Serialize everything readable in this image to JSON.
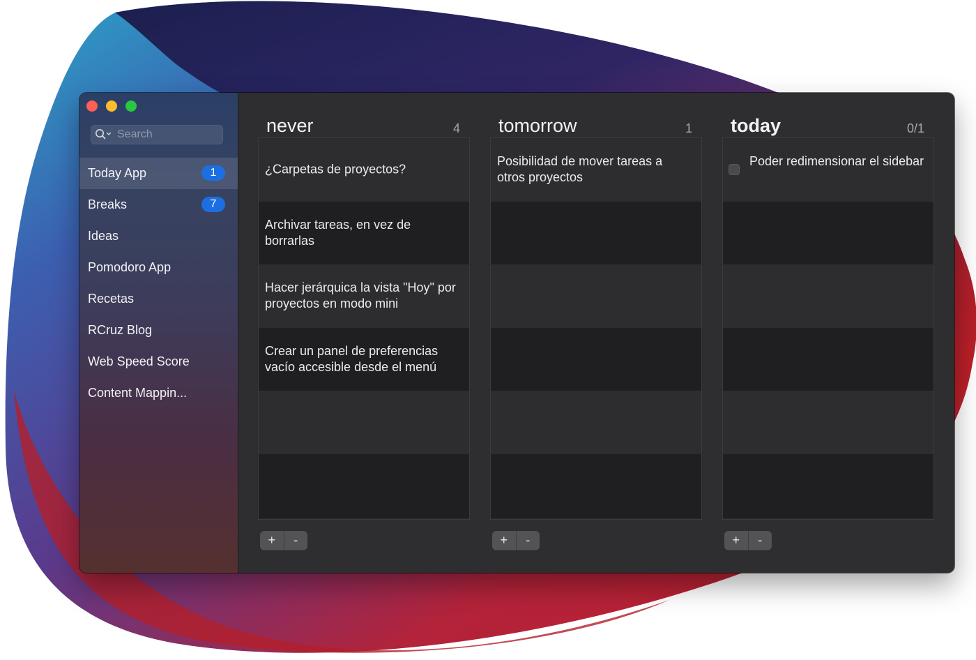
{
  "window": {
    "traffic_lights": [
      "close",
      "minimize",
      "zoom"
    ]
  },
  "sidebar": {
    "search": {
      "placeholder": "Search",
      "value": ""
    },
    "items": [
      {
        "label": "Today App",
        "badge": "1",
        "selected": true
      },
      {
        "label": "Breaks",
        "badge": "7",
        "selected": false
      },
      {
        "label": "Ideas",
        "badge": null,
        "selected": false
      },
      {
        "label": "Pomodoro App",
        "badge": null,
        "selected": false
      },
      {
        "label": "Recetas",
        "badge": null,
        "selected": false
      },
      {
        "label": "RCruz Blog",
        "badge": null,
        "selected": false
      },
      {
        "label": "Web Speed Score",
        "badge": null,
        "selected": false
      },
      {
        "label": "Content Mappin...",
        "badge": null,
        "selected": false
      }
    ]
  },
  "columns": [
    {
      "title": "never",
      "count": "4",
      "tasks": [
        {
          "text": "¿Carpetas de proyectos?"
        },
        {
          "text": "Archivar tareas, en vez de borrarlas"
        },
        {
          "text": "Hacer jerárquica la vista \"Hoy\" por proyectos en modo mini"
        },
        {
          "text": "Crear un panel de preferencias vacío accesible desde el menú"
        }
      ],
      "add_label": "+",
      "remove_label": "-"
    },
    {
      "title": "tomorrow",
      "count": "1",
      "tasks": [
        {
          "text": "Posibilidad de mover tareas a otros proyectos"
        }
      ],
      "add_label": "+",
      "remove_label": "-"
    },
    {
      "title": "today",
      "count": "0/1",
      "tasks": [
        {
          "text": "Poder redimensionar el sidebar",
          "checked": false
        }
      ],
      "add_label": "+",
      "remove_label": "-"
    }
  ],
  "colors": {
    "badge": "#1c6fe0",
    "close": "#fe5f57",
    "minimize": "#febc2e",
    "zoom": "#28c840"
  }
}
